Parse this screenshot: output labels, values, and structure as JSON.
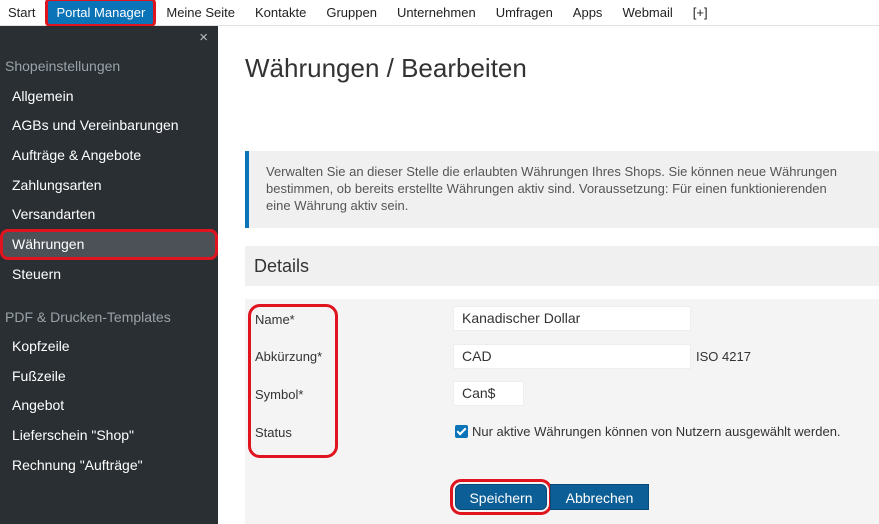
{
  "topnav": {
    "items": [
      "Start",
      "Portal Manager",
      "Meine Seite",
      "Kontakte",
      "Gruppen",
      "Unternehmen",
      "Umfragen",
      "Apps",
      "Webmail",
      "[+]"
    ],
    "active_index": 1
  },
  "sidebar": {
    "close_icon": "×",
    "section1": "Shopeinstellungen",
    "items1": [
      "Allgemein",
      "AGBs und Vereinbarungen",
      "Aufträge & Angebote",
      "Zahlungsarten",
      "Versandarten",
      "Währungen",
      "Steuern"
    ],
    "active_item": "Währungen",
    "section2": "PDF & Drucken-Templates",
    "items2": [
      "Kopfzeile",
      "Fußzeile",
      "Angebot",
      "Lieferschein \"Shop\"",
      "Rechnung \"Aufträge\""
    ]
  },
  "main": {
    "title": "Währungen / Bearbeiten",
    "info_lines": [
      "Verwalten Sie an dieser Stelle die erlaubten Währungen Ihres Shops. Sie können neue Währungen",
      "bestimmen, ob bereits erstellte Währungen aktiv sind. Voraussetzung: Für einen funktionierenden",
      "eine Währung aktiv sein."
    ],
    "details_heading": "Details",
    "form": {
      "name_label": "Name*",
      "name_value": "Kanadischer Dollar",
      "abbr_label": "Abkürzung*",
      "abbr_value": "CAD",
      "abbr_hint": "ISO 4217",
      "symbol_label": "Symbol*",
      "symbol_value": "Can$",
      "status_label": "Status",
      "status_checked": true,
      "status_text": "Nur aktive Währungen können von Nutzern ausgewählt werden."
    },
    "buttons": {
      "save": "Speichern",
      "cancel": "Abbrechen"
    }
  },
  "colors": {
    "accent": "#0b74b8",
    "highlight": "#e0141e",
    "sidebar_bg": "#2a2f33"
  }
}
